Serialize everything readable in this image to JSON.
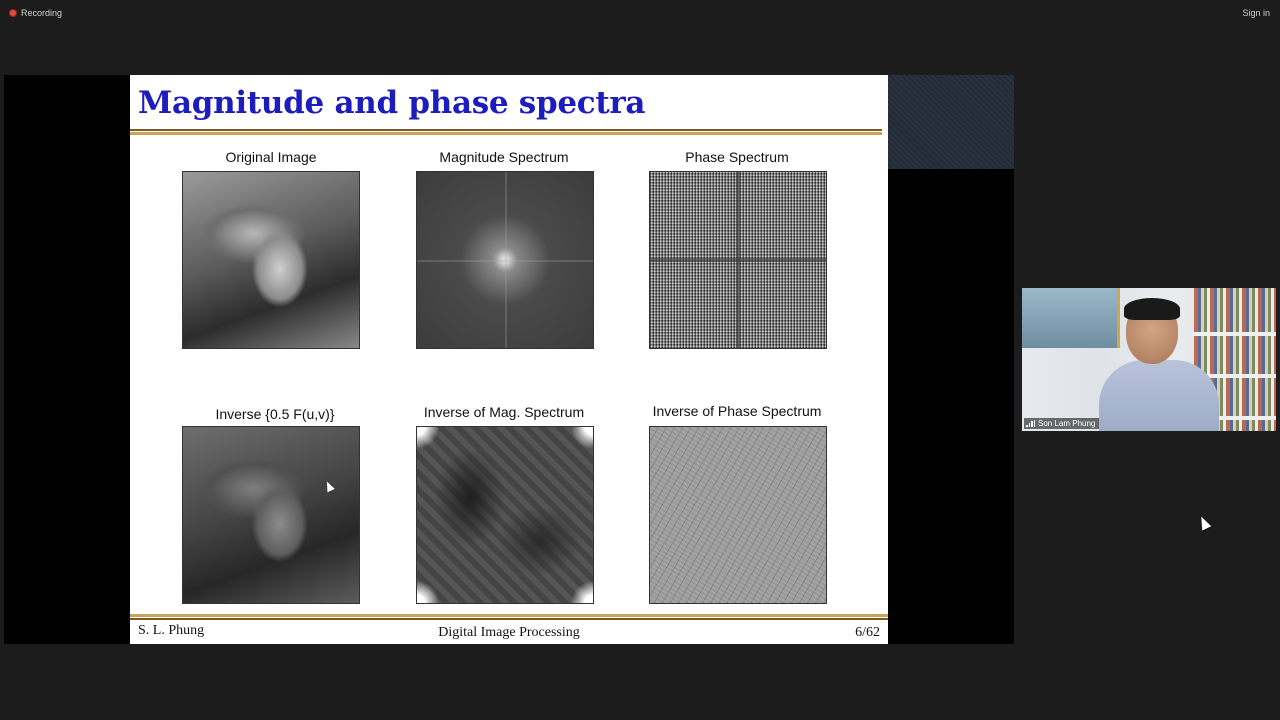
{
  "meeting": {
    "recording_label": "Recording",
    "sign_in_label": "Sign in"
  },
  "slide": {
    "title": "Magnitude and phase spectra",
    "panels": [
      {
        "caption": "Original Image"
      },
      {
        "caption": "Magnitude Spectrum"
      },
      {
        "caption": "Phase Spectrum"
      },
      {
        "caption": "Inverse {0.5 F(u,v)}"
      },
      {
        "caption": "Inverse of Mag. Spectrum"
      },
      {
        "caption": "Inverse of Phase Spectrum"
      }
    ],
    "footer": {
      "author": "S. L. Phung",
      "course": "Digital Image Processing",
      "page": "6/62"
    }
  },
  "video": {
    "participant_name": "Son Lam Phung"
  },
  "colors": {
    "title_blue": "#1c1cbf",
    "rule_gold": "#c9a45a",
    "recording_red": "#e8473c"
  }
}
